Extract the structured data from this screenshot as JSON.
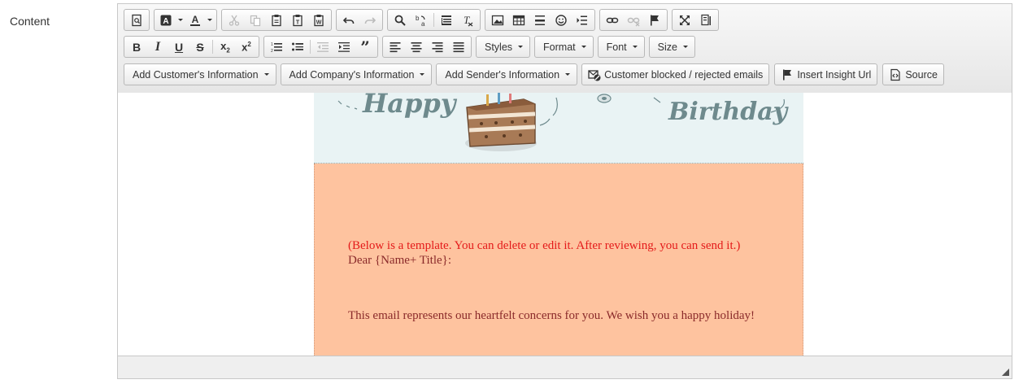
{
  "field": {
    "label": "Content"
  },
  "toolbar": {
    "styles_label": "Styles",
    "format_label": "Format",
    "font_label": "Font",
    "size_label": "Size",
    "insert_customer_label": "Add Customer's Information",
    "insert_company_label": "Add Company's Information",
    "insert_sender_label": "Add Sender's Information",
    "blocked_emails_label": "Customer blocked / rejected emails",
    "insight_url_label": "Insert Insight Url",
    "source_label": "Source"
  },
  "email": {
    "banner_left": "Happy",
    "banner_right": "Birthday",
    "template_note": "(Below is a template. You can delete or edit it. After reviewing, you can send it.)",
    "greeting": "Dear {Name+ Title}:",
    "body": "This email represents our heartfelt concerns for you. We wish you a happy holiday!"
  },
  "colors": {
    "card_bg": "#fec39f",
    "banner_bg": "#e9f3f4",
    "note_color": "#e41a1a",
    "body_text_color": "#8a2a2a"
  }
}
